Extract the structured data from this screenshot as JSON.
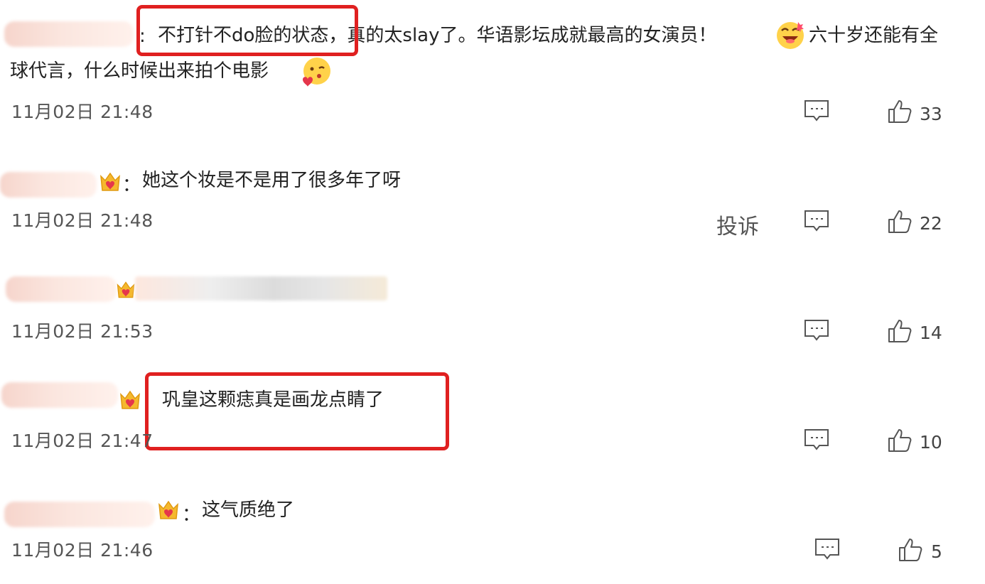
{
  "comments": [
    {
      "text_part1": "不打针不do脸的状态，真的太slay了。华语影坛成就最高的女演员！",
      "text_part2": "六十岁还能有全",
      "text_part3": "球代言，什么时候出来拍个电影",
      "colon": ":",
      "timestamp": "11月02日 21:48",
      "likes": "33"
    },
    {
      "colon": "：",
      "text": "她这个妆是不是用了很多年了呀",
      "timestamp": "11月02日 21:48",
      "report": "投诉",
      "likes": "22"
    },
    {
      "timestamp": "11月02日 21:53",
      "likes": "14"
    },
    {
      "text": "巩皇这颗痣真是画龙点睛了",
      "timestamp": "11月02日 21:47",
      "likes": "10"
    },
    {
      "colon": "：",
      "text": "这气质绝了",
      "timestamp": "11月02日 21:46",
      "likes": "5"
    }
  ],
  "colors": {
    "highlight_red": "#e02020",
    "text": "#222222",
    "meta": "#555555"
  },
  "icons": {
    "reply": "comment-bubble-icon",
    "like": "thumbs-up-icon",
    "vip": "crown-badge-icon",
    "emoji_laugh": "laughing-emoji-icon",
    "emoji_kiss": "kiss-emoji-icon"
  }
}
